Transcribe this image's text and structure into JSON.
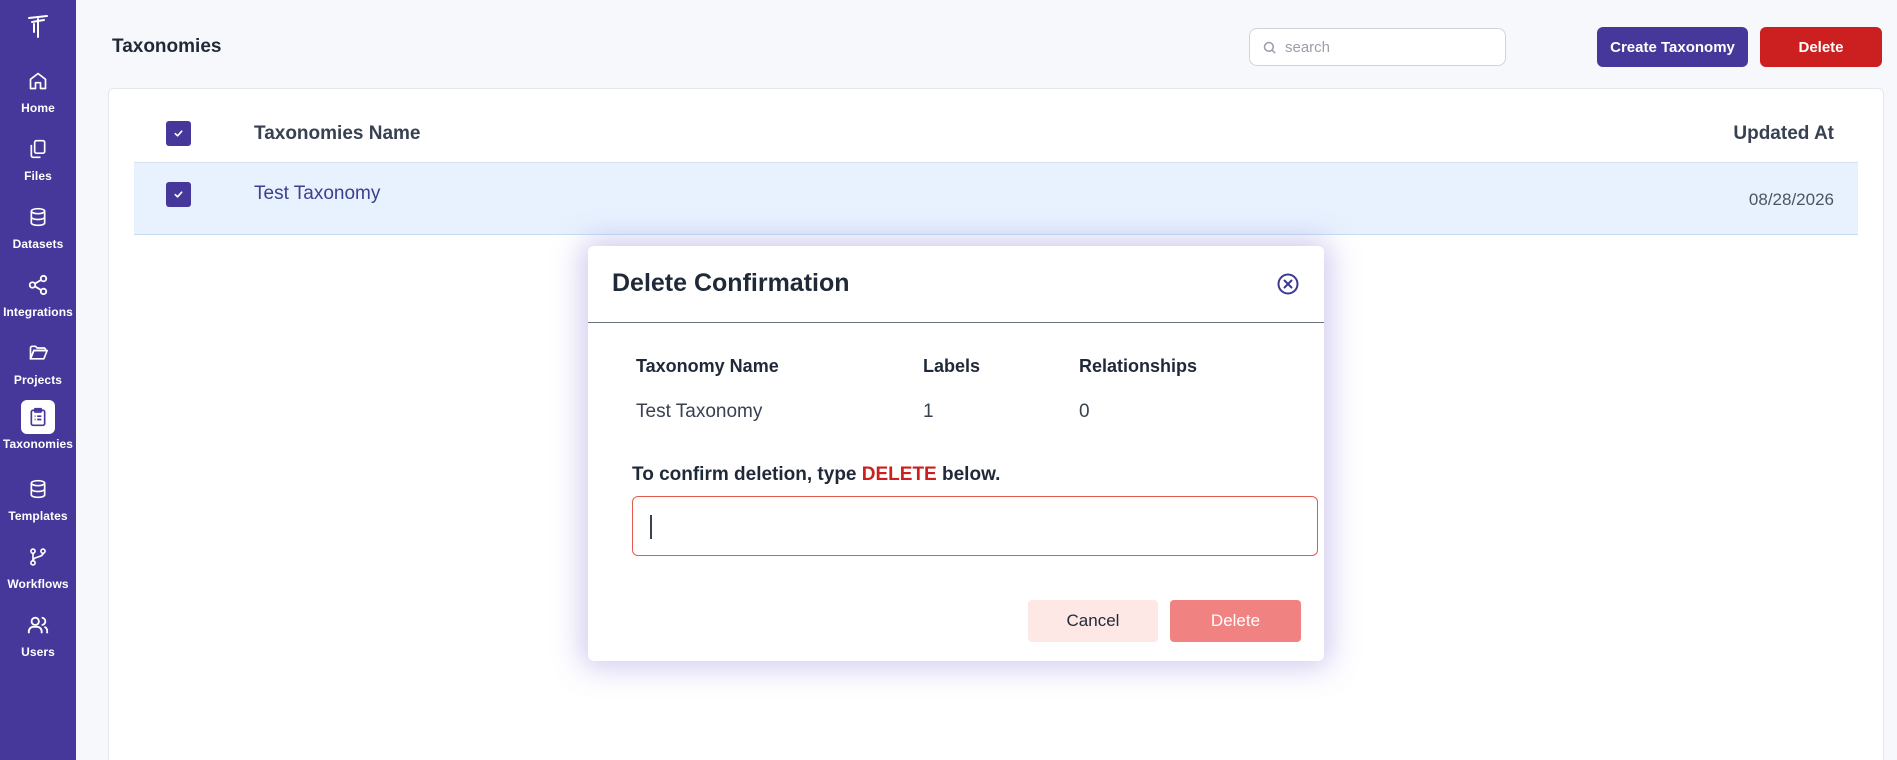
{
  "sidebar": {
    "items": [
      {
        "label": "Home",
        "icon": "home-icon"
      },
      {
        "label": "Files",
        "icon": "files-icon"
      },
      {
        "label": "Datasets",
        "icon": "database-icon"
      },
      {
        "label": "Integrations",
        "icon": "share-icon"
      },
      {
        "label": "Projects",
        "icon": "folder-icon"
      },
      {
        "label": "Taxonomies",
        "icon": "clipboard-icon",
        "active": true
      },
      {
        "label": "Templates",
        "icon": "database-icon"
      },
      {
        "label": "Workflows",
        "icon": "git-branch-icon"
      },
      {
        "label": "Users",
        "icon": "users-icon"
      }
    ]
  },
  "header": {
    "title": "Taxonomies",
    "search_placeholder": "search",
    "create_label": "Create Taxonomy",
    "delete_label": "Delete"
  },
  "table": {
    "columns": [
      "Taxonomies Name",
      "Updated At"
    ],
    "rows": [
      {
        "name": "Test Taxonomy",
        "updated": "08/28/2026",
        "checked": true
      }
    ],
    "select_all_checked": true
  },
  "modal": {
    "title": "Delete Confirmation",
    "columns": [
      "Taxonomy Name",
      "Labels",
      "Relationships"
    ],
    "values": [
      "Test Taxonomy",
      "1",
      "0"
    ],
    "confirm_prefix": "To confirm deletion, type ",
    "confirm_keyword": "DELETE",
    "confirm_suffix": " below.",
    "input_value": "",
    "cancel_label": "Cancel",
    "delete_label": "Delete"
  },
  "colors": {
    "brand": "#46389a",
    "danger": "#cc1f1f",
    "danger_disabled": "#f08282",
    "row_selected": "#e8f2fe"
  }
}
